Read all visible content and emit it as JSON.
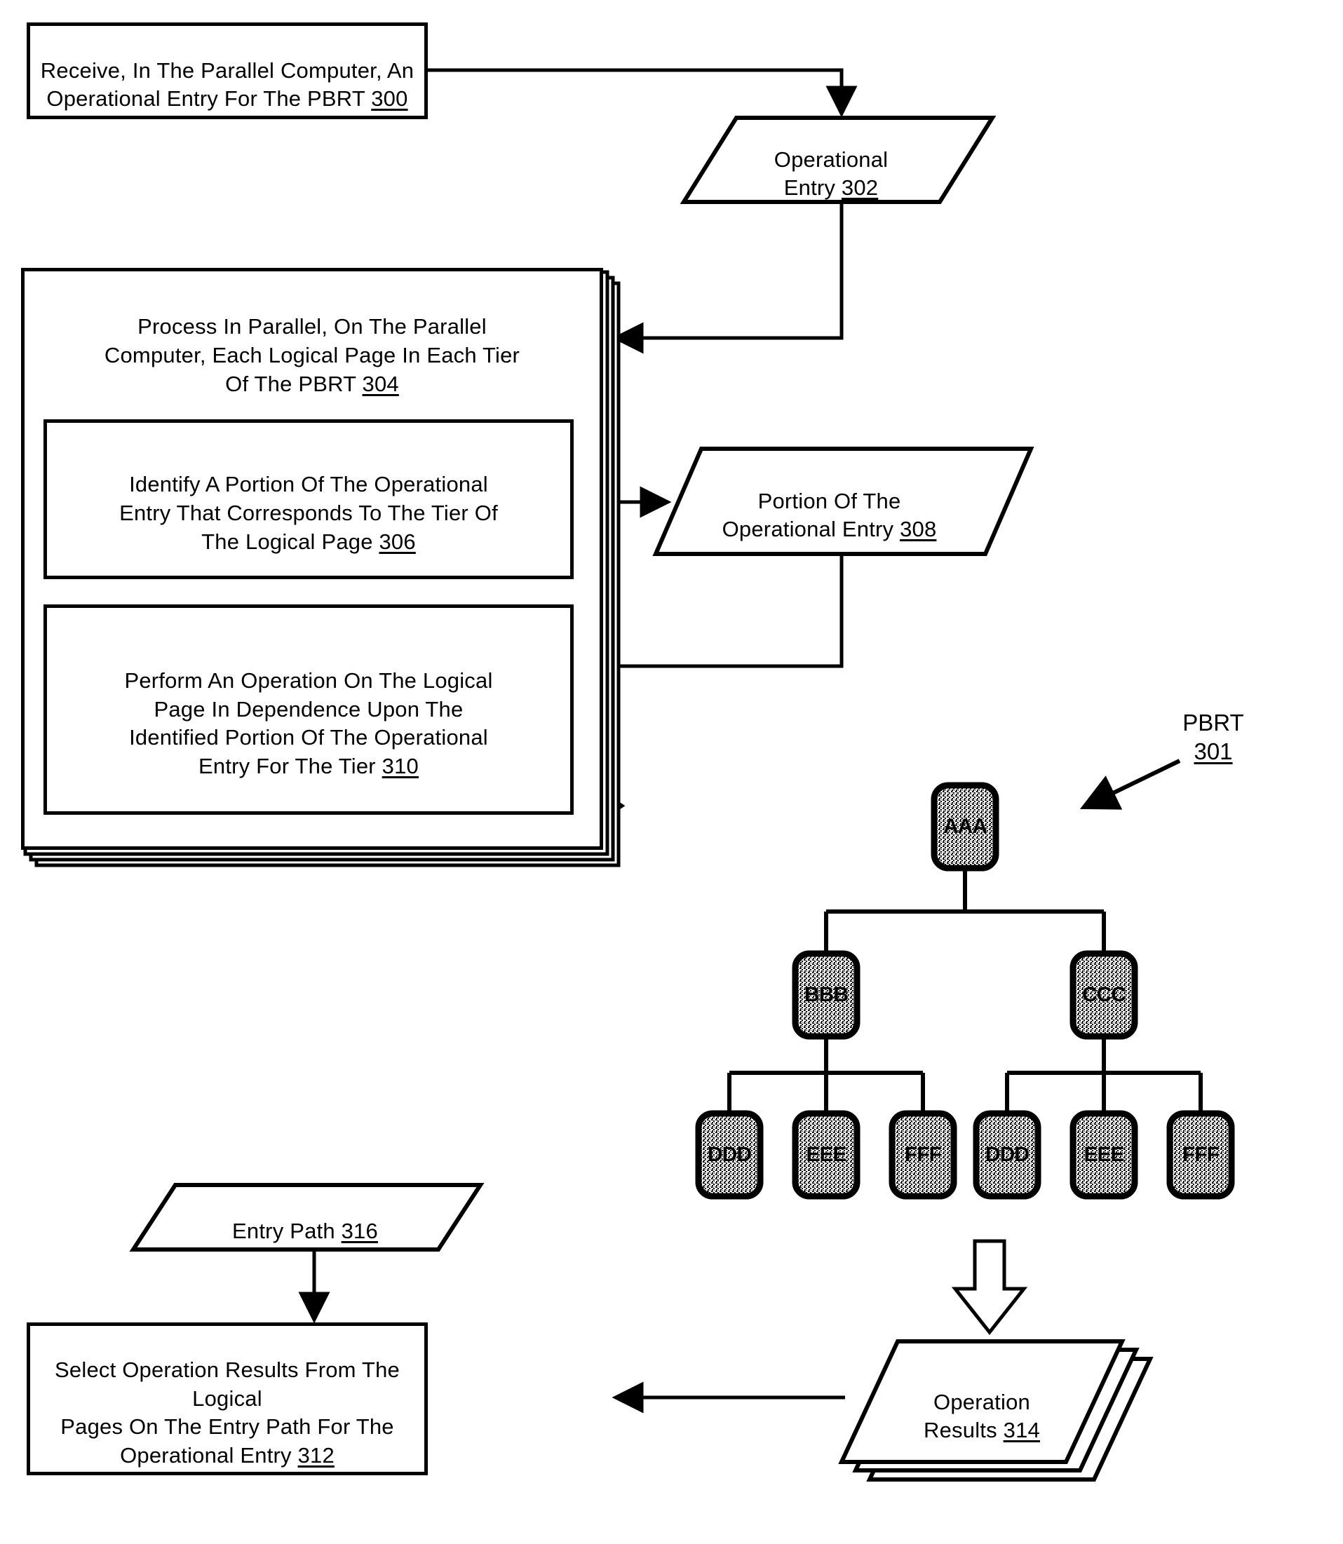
{
  "figure": {
    "title": "Parallel Bit Reversal Tree (PBRT) processing flowchart",
    "pbrt_callout": {
      "name": "PBRT",
      "ref": "301"
    }
  },
  "steps": {
    "receive": {
      "text": "Receive, In The Parallel Computer, An\nOperational Entry For The PBRT ",
      "ref": "300"
    },
    "process_parallel": {
      "text": "Process In Parallel, On The Parallel\nComputer, Each Logical Page In Each Tier\nOf The PBRT ",
      "ref": "304"
    },
    "identify_portion": {
      "text": "Identify A Portion Of The Operational\nEntry That Corresponds To The Tier Of\nThe Logical Page ",
      "ref": "306"
    },
    "perform_operation": {
      "text": "Perform An Operation On The Logical\nPage In Dependence Upon The\nIdentified Portion Of The Operational\nEntry For The Tier ",
      "ref": "310"
    },
    "select_results": {
      "text": "Select Operation Results From The Logical\nPages On The Entry Path For The\nOperational Entry ",
      "ref": "312"
    }
  },
  "data_objects": {
    "operational_entry": {
      "text": "Operational\nEntry ",
      "ref": "302"
    },
    "portion_of_entry": {
      "text": "Portion Of The\nOperational Entry ",
      "ref": "308"
    },
    "entry_path": {
      "text": "Entry Path ",
      "ref": "316"
    },
    "operation_results": {
      "text": "Operation\nResults ",
      "ref": "314"
    }
  },
  "tree": {
    "root": {
      "label": "AAA"
    },
    "tier2": [
      {
        "label": "BBB"
      },
      {
        "label": "CCC"
      }
    ],
    "tier3": [
      {
        "label": "DDD"
      },
      {
        "label": "EEE"
      },
      {
        "label": "FFF"
      },
      {
        "label": "DDD"
      },
      {
        "label": "EEE"
      },
      {
        "label": "FFF"
      }
    ]
  },
  "colors": {
    "ink": "#000000",
    "paper": "#ffffff",
    "node_fill": "#b4b4b4"
  }
}
